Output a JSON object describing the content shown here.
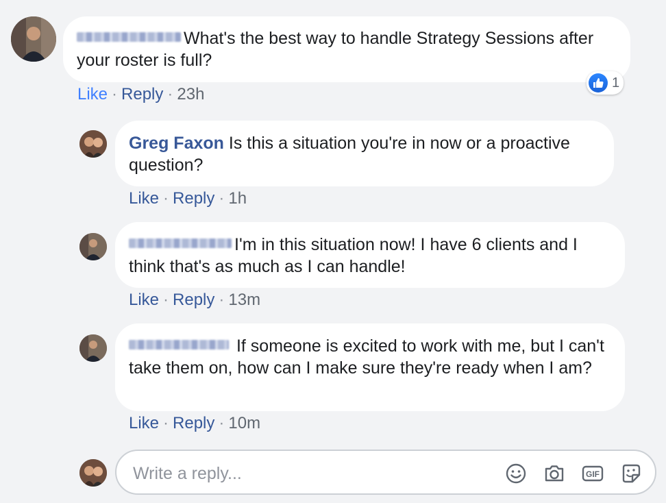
{
  "thread": {
    "parent": {
      "text": "What's the best way to handle Strategy Sessions after your roster is full?",
      "actions": {
        "like": "Like",
        "reply": "Reply",
        "time": "23h"
      },
      "reaction_count": "1"
    },
    "replies": [
      {
        "author": "Greg Faxon",
        "text": "Is this a situation you're in now or a proactive question?",
        "actions": {
          "like": "Like",
          "reply": "Reply",
          "time": "1h"
        }
      },
      {
        "author": "",
        "text": "I'm in this situation now! I have 6 clients and I think that's as much as I can handle!",
        "actions": {
          "like": "Like",
          "reply": "Reply",
          "time": "13m"
        }
      },
      {
        "author": "",
        "text": "If someone is excited to work with me, but I can't take them on, how can I make sure they're ready when I am?",
        "actions": {
          "like": "Like",
          "reply": "Reply",
          "time": "10m"
        }
      }
    ]
  },
  "composer": {
    "placeholder": "Write a reply...",
    "icons": [
      "emoji-icon",
      "camera-icon",
      "gif-icon",
      "sticker-icon"
    ],
    "gif_label": "GIF"
  },
  "colors": {
    "background": "#f2f3f5",
    "link": "#4267b2",
    "name": "#385898",
    "like_badge": "#1a62d8"
  }
}
